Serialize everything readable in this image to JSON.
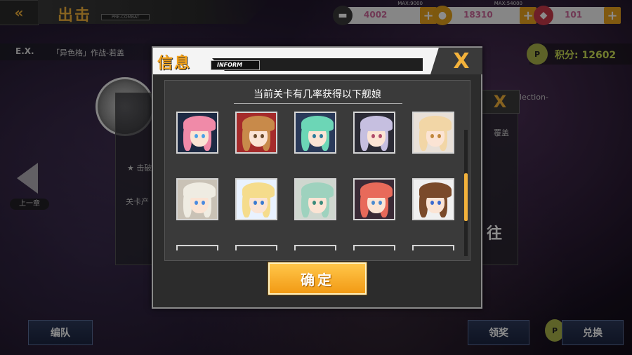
{
  "topbar": {
    "title": "出击",
    "title_sub": "PRE-COMBAT",
    "resources": [
      {
        "name": "oil",
        "icon": "fuel-icon",
        "cap": "MAX:9000",
        "value": "4002"
      },
      {
        "name": "ammo",
        "icon": "coin-icon",
        "cap": "MAX:54000",
        "value": "18310"
      },
      {
        "name": "gem",
        "icon": "diamond-icon",
        "value": "101"
      }
    ]
  },
  "background": {
    "stage_code": "E.X.",
    "stage_name": "「异色格」作战-若盖",
    "rank_label": "积分: 12602",
    "prev_label": "上一章",
    "under_text_1": "击破",
    "under_text_2": "覆盖",
    "under_text_3": "关卡产",
    "under_section": "lection-",
    "under_go": "往",
    "bottom_left_label": "编队",
    "bottom_mid_label": "领奖",
    "bottom_right_label": "兑换"
  },
  "modal": {
    "title": "信息",
    "tag": "INFORM",
    "close_label": "X",
    "body_title": "当前关卡有几率获得以下舰娘",
    "confirm_label": "确定",
    "characters": [
      {
        "hair": "#f08aa8",
        "eyes": "#4aa0e8",
        "accent": "#1d2a44"
      },
      {
        "hair": "#c88a4a",
        "eyes": "#6a4a2a",
        "accent": "#a52b2b"
      },
      {
        "hair": "#6cd6b6",
        "eyes": "#2a7a9a",
        "accent": "#2a3a5a"
      },
      {
        "hair": "#c6bfe0",
        "eyes": "#b04a6a",
        "accent": "#2b2b35"
      },
      {
        "hair": "#f2d6a6",
        "eyes": "#c0863a",
        "accent": "#e8e0d8"
      },
      {
        "hair": "#efece2",
        "eyes": "#4a8ae0",
        "accent": "#c9c2b6"
      },
      {
        "hair": "#f5dc8c",
        "eyes": "#3a7ad0",
        "accent": "#e9f2ff"
      },
      {
        "hair": "#9ed2be",
        "eyes": "#3a8a7a",
        "accent": "#cfd7cf"
      },
      {
        "hair": "#e86a5a",
        "eyes": "#4a8ad0",
        "accent": "#3a2a36"
      },
      {
        "hair": "#7a4a2a",
        "eyes": "#3a6ad0",
        "accent": "#f0f0f0"
      }
    ]
  }
}
